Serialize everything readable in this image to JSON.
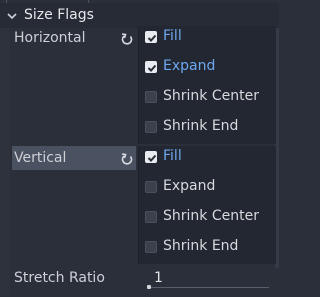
{
  "section": {
    "title": "Size Flags",
    "icon": "chevron-down-icon"
  },
  "horizontal": {
    "label": "Horizontal",
    "revert_icon": "revert-icon",
    "flags": [
      {
        "label": "Fill",
        "checked": true
      },
      {
        "label": "Expand",
        "checked": true
      },
      {
        "label": "Shrink Center",
        "checked": false
      },
      {
        "label": "Shrink End",
        "checked": false
      }
    ]
  },
  "vertical": {
    "label": "Vertical",
    "revert_icon": "revert-icon",
    "flags": [
      {
        "label": "Fill",
        "checked": true
      },
      {
        "label": "Expand",
        "checked": false
      },
      {
        "label": "Shrink Center",
        "checked": false
      },
      {
        "label": "Shrink End",
        "checked": false
      }
    ]
  },
  "stretch_ratio": {
    "label": "Stretch Ratio",
    "value": "1"
  },
  "colors": {
    "accent": "#6ea8f0",
    "background": "#2a2f3a",
    "panel": "#222731",
    "highlight_row": "#4a5161"
  }
}
